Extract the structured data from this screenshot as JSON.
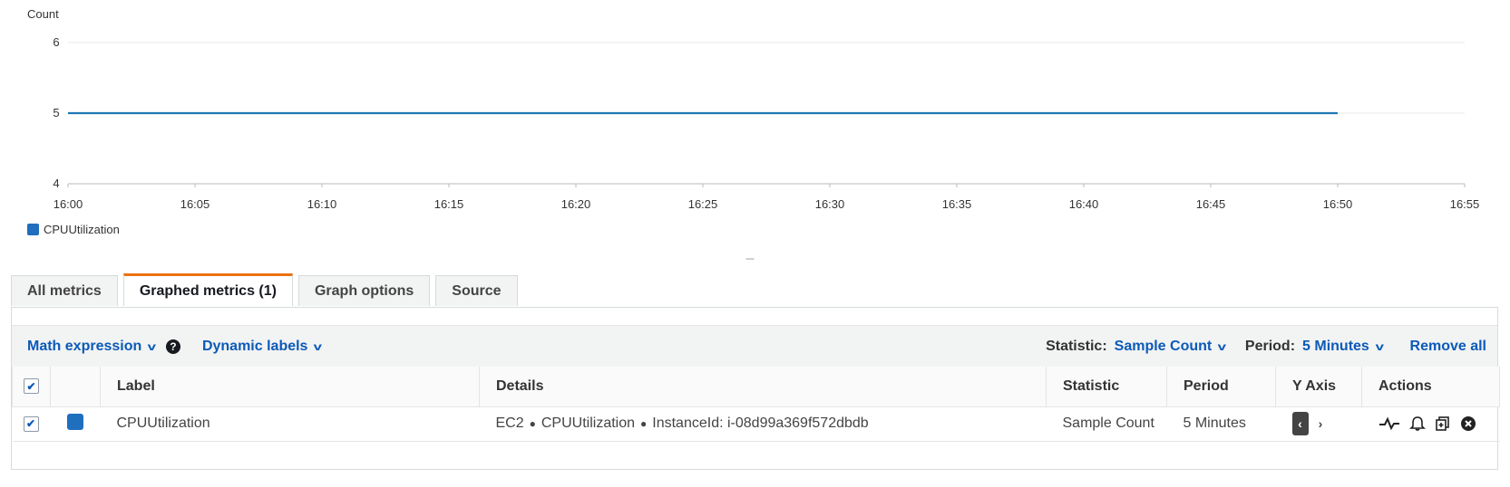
{
  "chart_data": {
    "type": "line",
    "ylabel": "Count",
    "ylim": [
      4,
      6
    ],
    "y_ticks": [
      "6",
      "5",
      "4"
    ],
    "x_ticks": [
      "16:00",
      "16:05",
      "16:10",
      "16:15",
      "16:20",
      "16:25",
      "16:30",
      "16:35",
      "16:40",
      "16:45",
      "16:50",
      "16:55"
    ],
    "series": [
      {
        "name": "CPUUtilization",
        "color": "#1f77b4",
        "x": [
          "16:00",
          "16:05",
          "16:10",
          "16:15",
          "16:20",
          "16:25",
          "16:30",
          "16:35",
          "16:40",
          "16:45",
          "16:50"
        ],
        "values": [
          5,
          5,
          5,
          5,
          5,
          5,
          5,
          5,
          5,
          5,
          5
        ]
      }
    ],
    "grid": true,
    "legend": "bottom-left"
  },
  "legend": {
    "label": "CPUUtilization"
  },
  "tabs": [
    {
      "label": "All metrics"
    },
    {
      "label": "Graphed metrics (1)"
    },
    {
      "label": "Graph options"
    },
    {
      "label": "Source"
    }
  ],
  "toolbar": {
    "math_expression": "Math expression",
    "dynamic_labels": "Dynamic labels",
    "help_icon": "?",
    "statistic_label": "Statistic:",
    "statistic_value": "Sample Count",
    "period_label": "Period:",
    "period_value": "5 Minutes",
    "remove_all": "Remove all"
  },
  "table": {
    "headers": {
      "label": "Label",
      "details": "Details",
      "statistic": "Statistic",
      "period": "Period",
      "y_axis": "Y Axis",
      "actions": "Actions"
    },
    "rows": [
      {
        "color": "#1f6fbe",
        "label": "CPUUtilization",
        "details_ns": "EC2",
        "details_metric": "CPUUtilization",
        "details_dim": "InstanceId: i-08d99a369f572dbdb",
        "statistic": "Sample Count",
        "period": "5 Minutes"
      }
    ]
  },
  "icons": {
    "checkbox": "✔",
    "yaxis_left": "‹",
    "yaxis_right": "›",
    "chevron": "v"
  }
}
